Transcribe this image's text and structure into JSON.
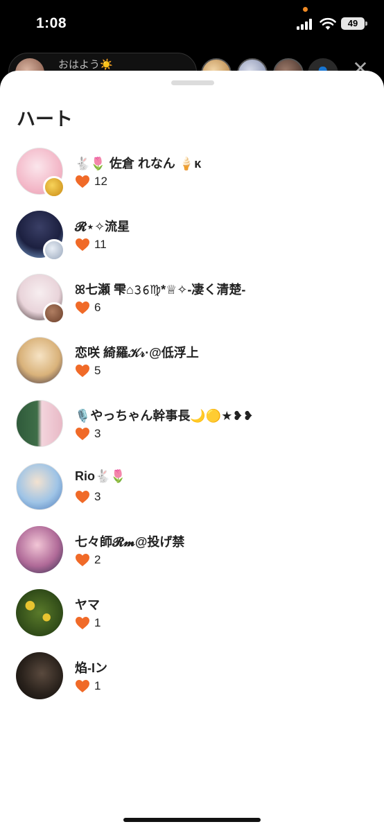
{
  "status_bar": {
    "time": "1:08",
    "battery": "49"
  },
  "live_header": {
    "comment_text": "おはよう☀️",
    "close_label": "✕",
    "person_icon": "person-icon"
  },
  "sheet": {
    "title": "ハート",
    "heart_color": "#f06a28",
    "items": [
      {
        "name": "🐇🌷 佐倉 れなん 🍦ᴋ",
        "count": "12"
      },
      {
        "name": "𝓡⋆✧流星",
        "count": "11"
      },
      {
        "name": "ꕤ七瀬 雫⌂𝟹𝟼♍︎*♕✧-凄く清楚-",
        "count": "6"
      },
      {
        "name": "恋咲 綺羅𝒦𝓇·@低浮上",
        "count": "5"
      },
      {
        "name": "🎙️やっちゃん幹事長🌙🟡★❥❥",
        "count": "3"
      },
      {
        "name": "Rio🐇🌷",
        "count": "3"
      },
      {
        "name": "七々師𝓡𝓶@投げ禁",
        "count": "2"
      },
      {
        "name": "ヤマ",
        "count": "1"
      },
      {
        "name": "焰-Iン",
        "count": "1"
      }
    ]
  }
}
